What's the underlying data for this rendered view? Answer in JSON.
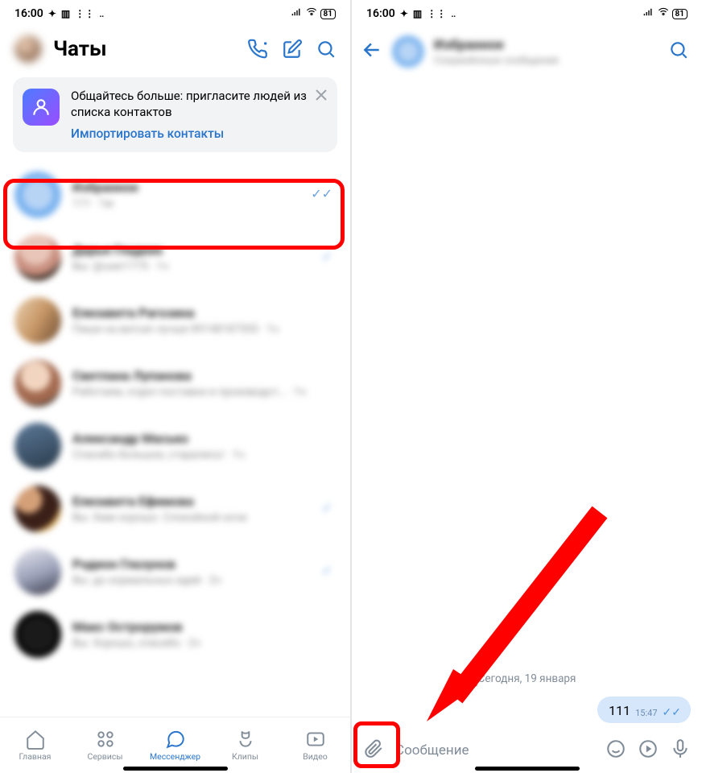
{
  "status": {
    "time": "16:00",
    "battery": "81"
  },
  "left": {
    "title": "Чаты",
    "invite_text": "Общайтесь больше: пригласите людей из списка контактов",
    "invite_link": "Импортировать контакты",
    "chats": [
      {
        "name": "Избранное",
        "sub": "111 · 1м"
      },
      {
        "name": "Дарья Гладких",
        "sub": "Вы: @user1775 · 1ч"
      },
      {
        "name": "Елизавета Рагозина",
        "sub": "Пиши на ватсап лучше 89148187555 · 1ч"
      },
      {
        "name": "Светлана Лупанова",
        "sub": "Работаем, отдел поставки и производст… · 1ч"
      },
      {
        "name": "Александр Масько",
        "sub": "Спасибо большое, старались! · 1ч"
      },
      {
        "name": "Елизавета Ефимова",
        "sub": "Вы: Хмм хорошо. Спокойной ночи"
      },
      {
        "name": "Родион Глазунов",
        "sub": "Вы: до нормальных идей · 2ч"
      },
      {
        "name": "Макс Острорумов",
        "sub": "Вы: Хорошо, спасибо · 2ч"
      }
    ],
    "nav": {
      "home": "Главная",
      "services": "Сервисы",
      "messenger": "Мессенджер",
      "clips": "Клипы",
      "video": "Видео"
    }
  },
  "right": {
    "name": "Избранное",
    "sub": "Сохранённые сообщения",
    "date": "Сегодня, 19 января",
    "message_text": "111",
    "message_time": "15:47",
    "composer_placeholder": "Сообщение"
  }
}
